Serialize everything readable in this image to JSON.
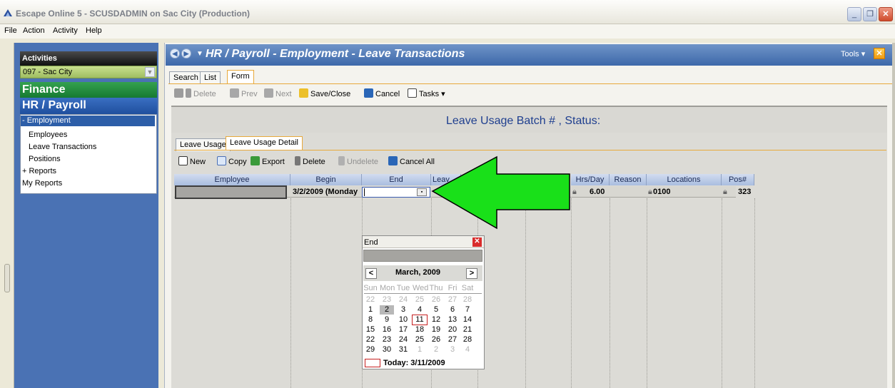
{
  "window": {
    "title": "Escape Online 5 - SCUSDADMIN on Sac City (Production)"
  },
  "menubar": [
    "File",
    "Action",
    "Activity",
    "Help"
  ],
  "left_panel": {
    "header": "Activities",
    "district": "097 - Sac City",
    "finance": "Finance",
    "hr": "HR / Payroll",
    "tree": {
      "employment": "- Employment",
      "employees": "Employees",
      "leave_transactions": "Leave Transactions",
      "positions": "Positions",
      "reports": "+ Reports",
      "my_reports": "My Reports"
    }
  },
  "breadcrumb": {
    "title": "HR / Payroll - Employment - Leave Transactions",
    "tools": "Tools"
  },
  "view_tabs": [
    "Search",
    "List",
    "Form"
  ],
  "main_toolbar": {
    "delete": "Delete",
    "prev": "Prev",
    "next": "Next",
    "save_close": "Save/Close",
    "cancel": "Cancel",
    "tasks": "Tasks"
  },
  "form": {
    "batch_title": "Leave Usage Batch # , Status:"
  },
  "detail_tabs": [
    "Leave Usage",
    "Leave Usage Detail"
  ],
  "detail_toolbar": {
    "new": "New",
    "copy": "Copy",
    "export": "Export",
    "delete": "Delete",
    "undelete": "Undelete",
    "cancel_all": "Cancel All"
  },
  "grid": {
    "columns": [
      "Employee",
      "Begin",
      "End",
      "Leav",
      "Hrs/Day",
      "Reason",
      "Locations",
      "Pos#"
    ],
    "row": {
      "begin": "3/2/2009 (Monday",
      "hrs_day": "6.00",
      "locations": "0100",
      "pos": "323"
    }
  },
  "calendar": {
    "title": "End",
    "month": "March, 2009",
    "weekdays": [
      "Sun",
      "Mon",
      "Tue",
      "Wed",
      "Thu",
      "Fri",
      "Sat"
    ],
    "weeks": [
      [
        "22",
        "23",
        "24",
        "25",
        "26",
        "27",
        "28"
      ],
      [
        "1",
        "2",
        "3",
        "4",
        "5",
        "6",
        "7"
      ],
      [
        "8",
        "9",
        "10",
        "11",
        "12",
        "13",
        "14"
      ],
      [
        "15",
        "16",
        "17",
        "18",
        "19",
        "20",
        "21"
      ],
      [
        "22",
        "23",
        "24",
        "25",
        "26",
        "27",
        "28"
      ],
      [
        "29",
        "30",
        "31",
        "1",
        "2",
        "3",
        "4"
      ]
    ],
    "today": "Today: 3/11/2009",
    "prev": "<",
    "next": ">"
  },
  "colors": {
    "finance": "#167a31",
    "hr": "#1f4f9e",
    "arrow": "#19e019",
    "tab_accent": "#e8a93b"
  }
}
